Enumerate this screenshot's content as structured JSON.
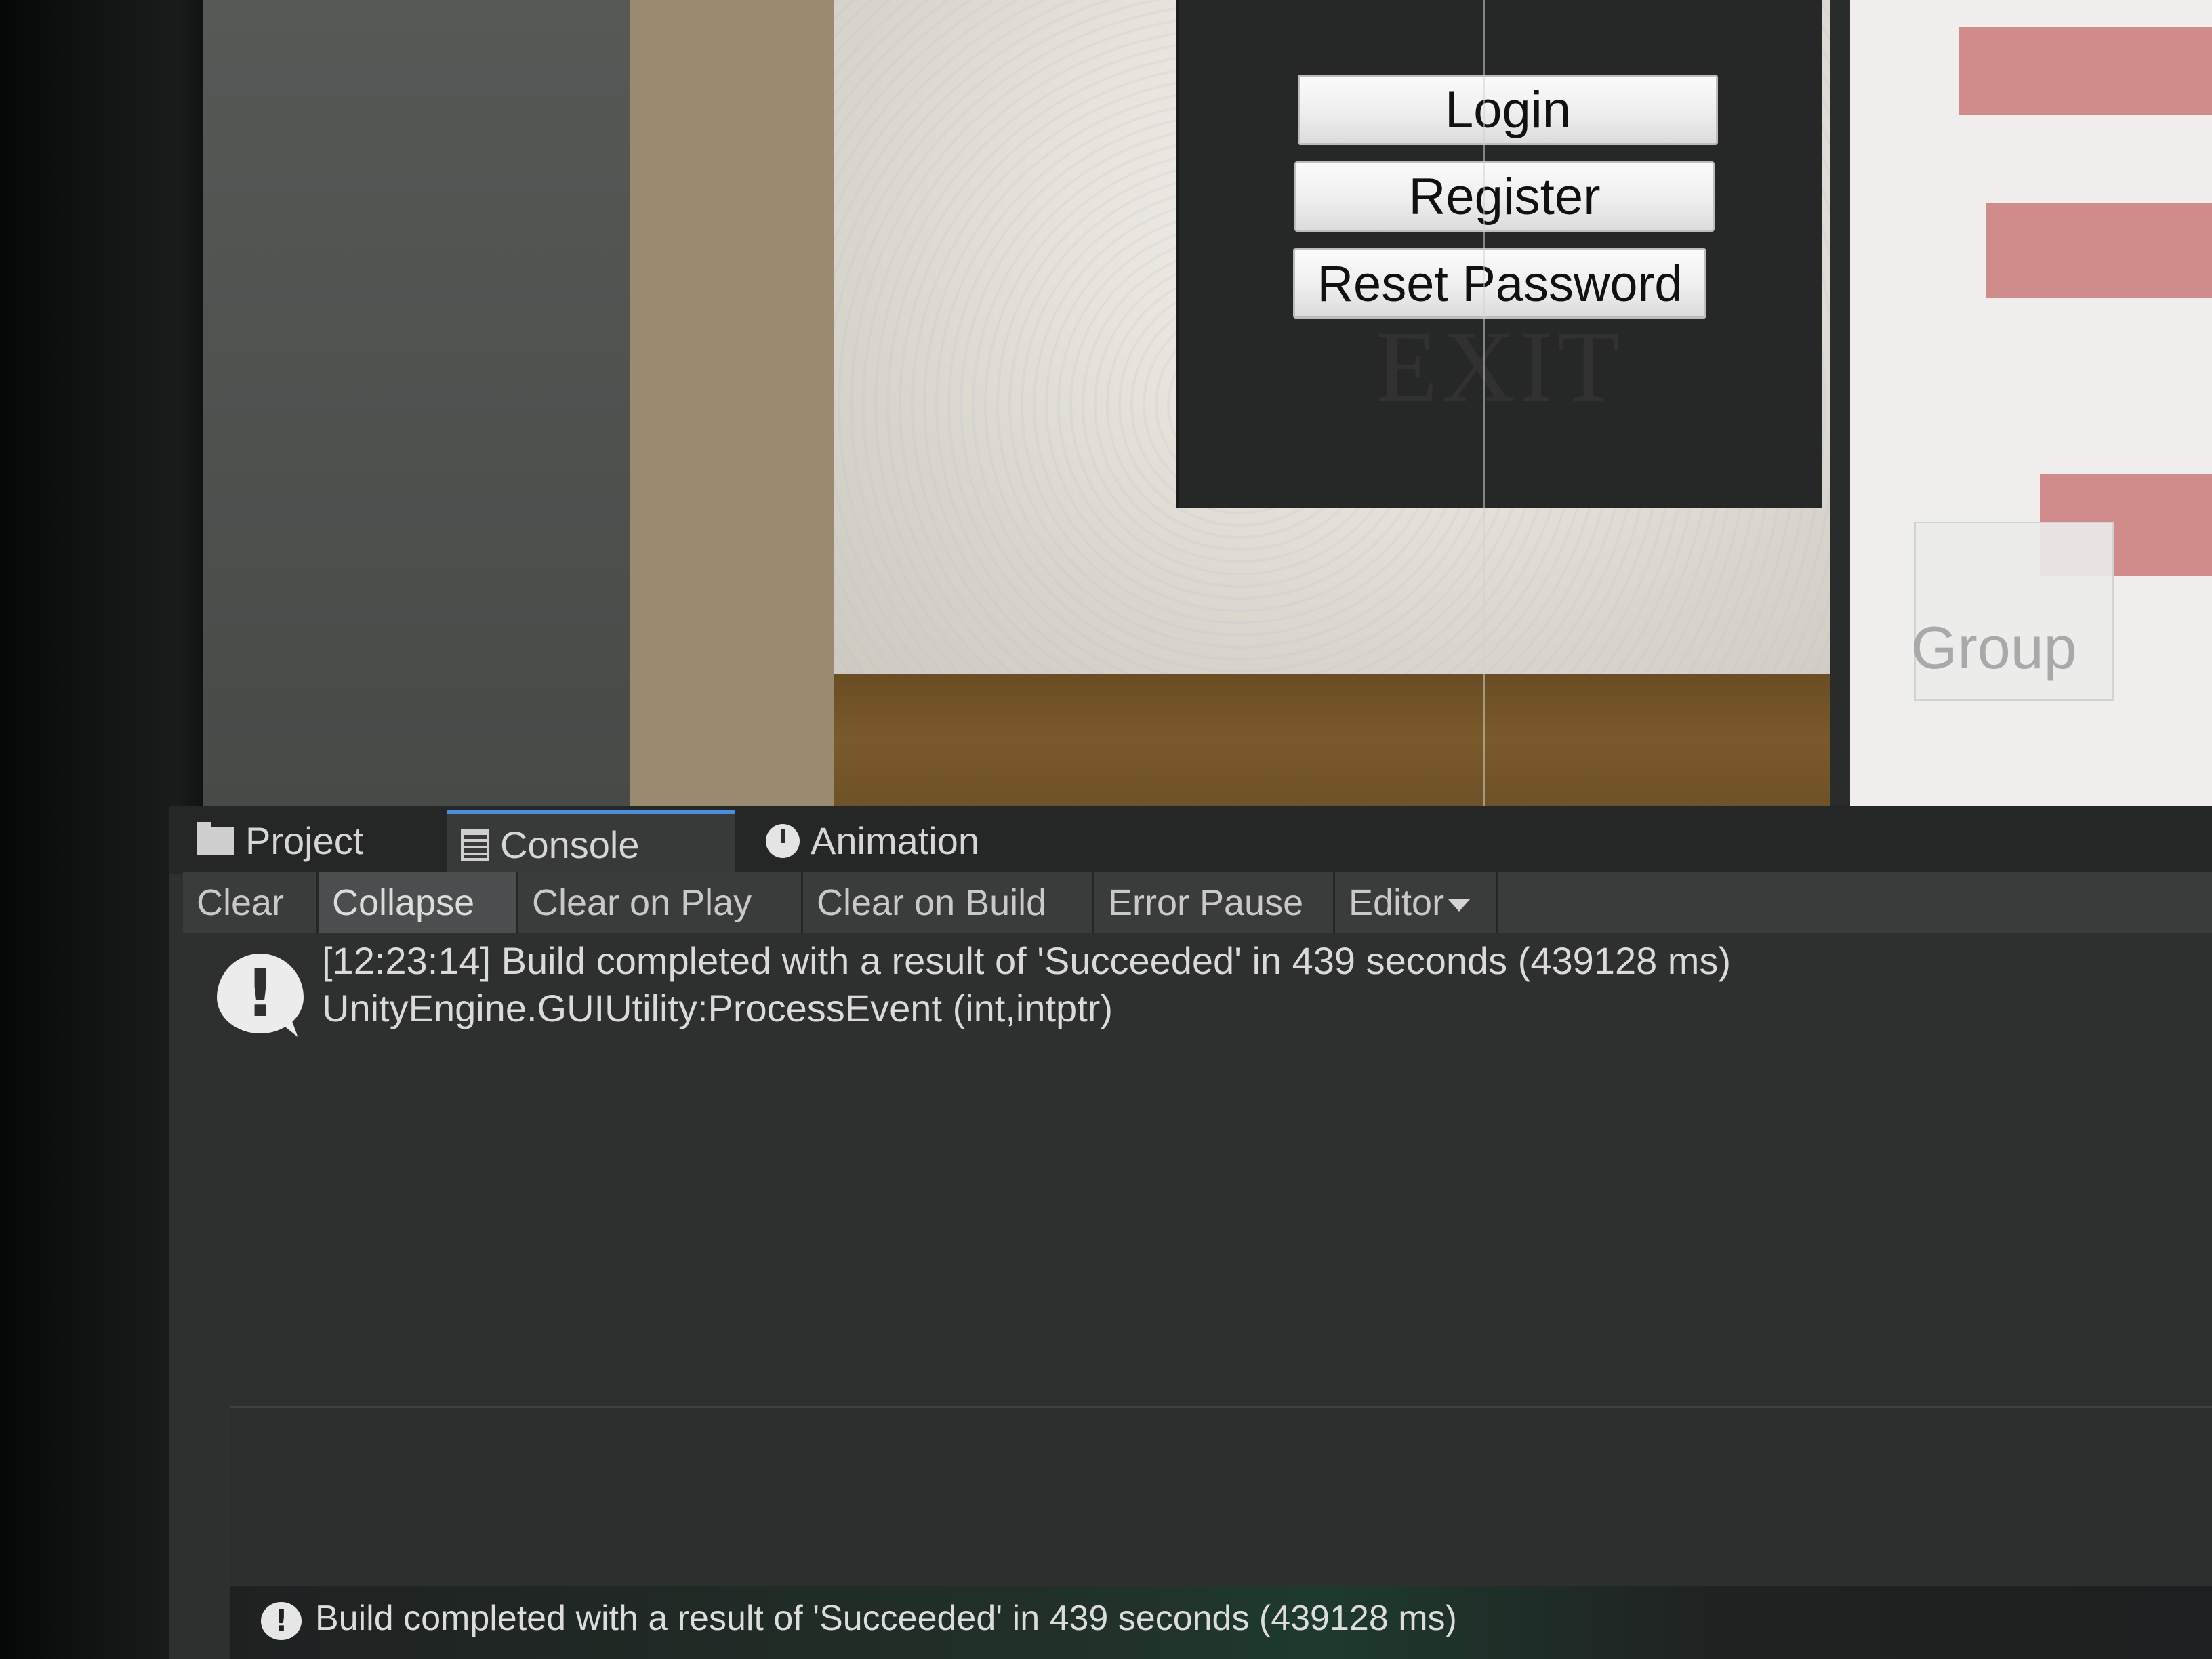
{
  "game_view": {
    "buttons": [
      "Login",
      "Register",
      "Reset Password"
    ],
    "exit_label": "EXIT"
  },
  "scene_label": "Group",
  "tabs": [
    {
      "label": "Project",
      "icon": "folder-icon"
    },
    {
      "label": "Console",
      "icon": "console-icon",
      "active": true
    },
    {
      "label": "Animation",
      "icon": "clock-icon"
    }
  ],
  "toolbar": {
    "clear": "Clear",
    "collapse": "Collapse",
    "clear_on_play": "Clear on Play",
    "clear_on_build": "Clear on Build",
    "error_pause": "Error Pause",
    "editor": "Editor"
  },
  "log": {
    "icon": "info-icon",
    "line1": "[12:23:14] Build completed with a result of 'Succeeded' in 439 seconds (439128 ms)",
    "line2": "UnityEngine.GUIUtility:ProcessEvent (int,intptr)"
  },
  "status": {
    "icon": "info-icon",
    "text": "Build completed with a result of 'Succeeded' in 439 seconds (439128 ms)"
  },
  "colors": {
    "editor_bg": "#2e3030",
    "tab_active_accent": "#4c8ed8",
    "button_bg": "#eeeeee"
  }
}
